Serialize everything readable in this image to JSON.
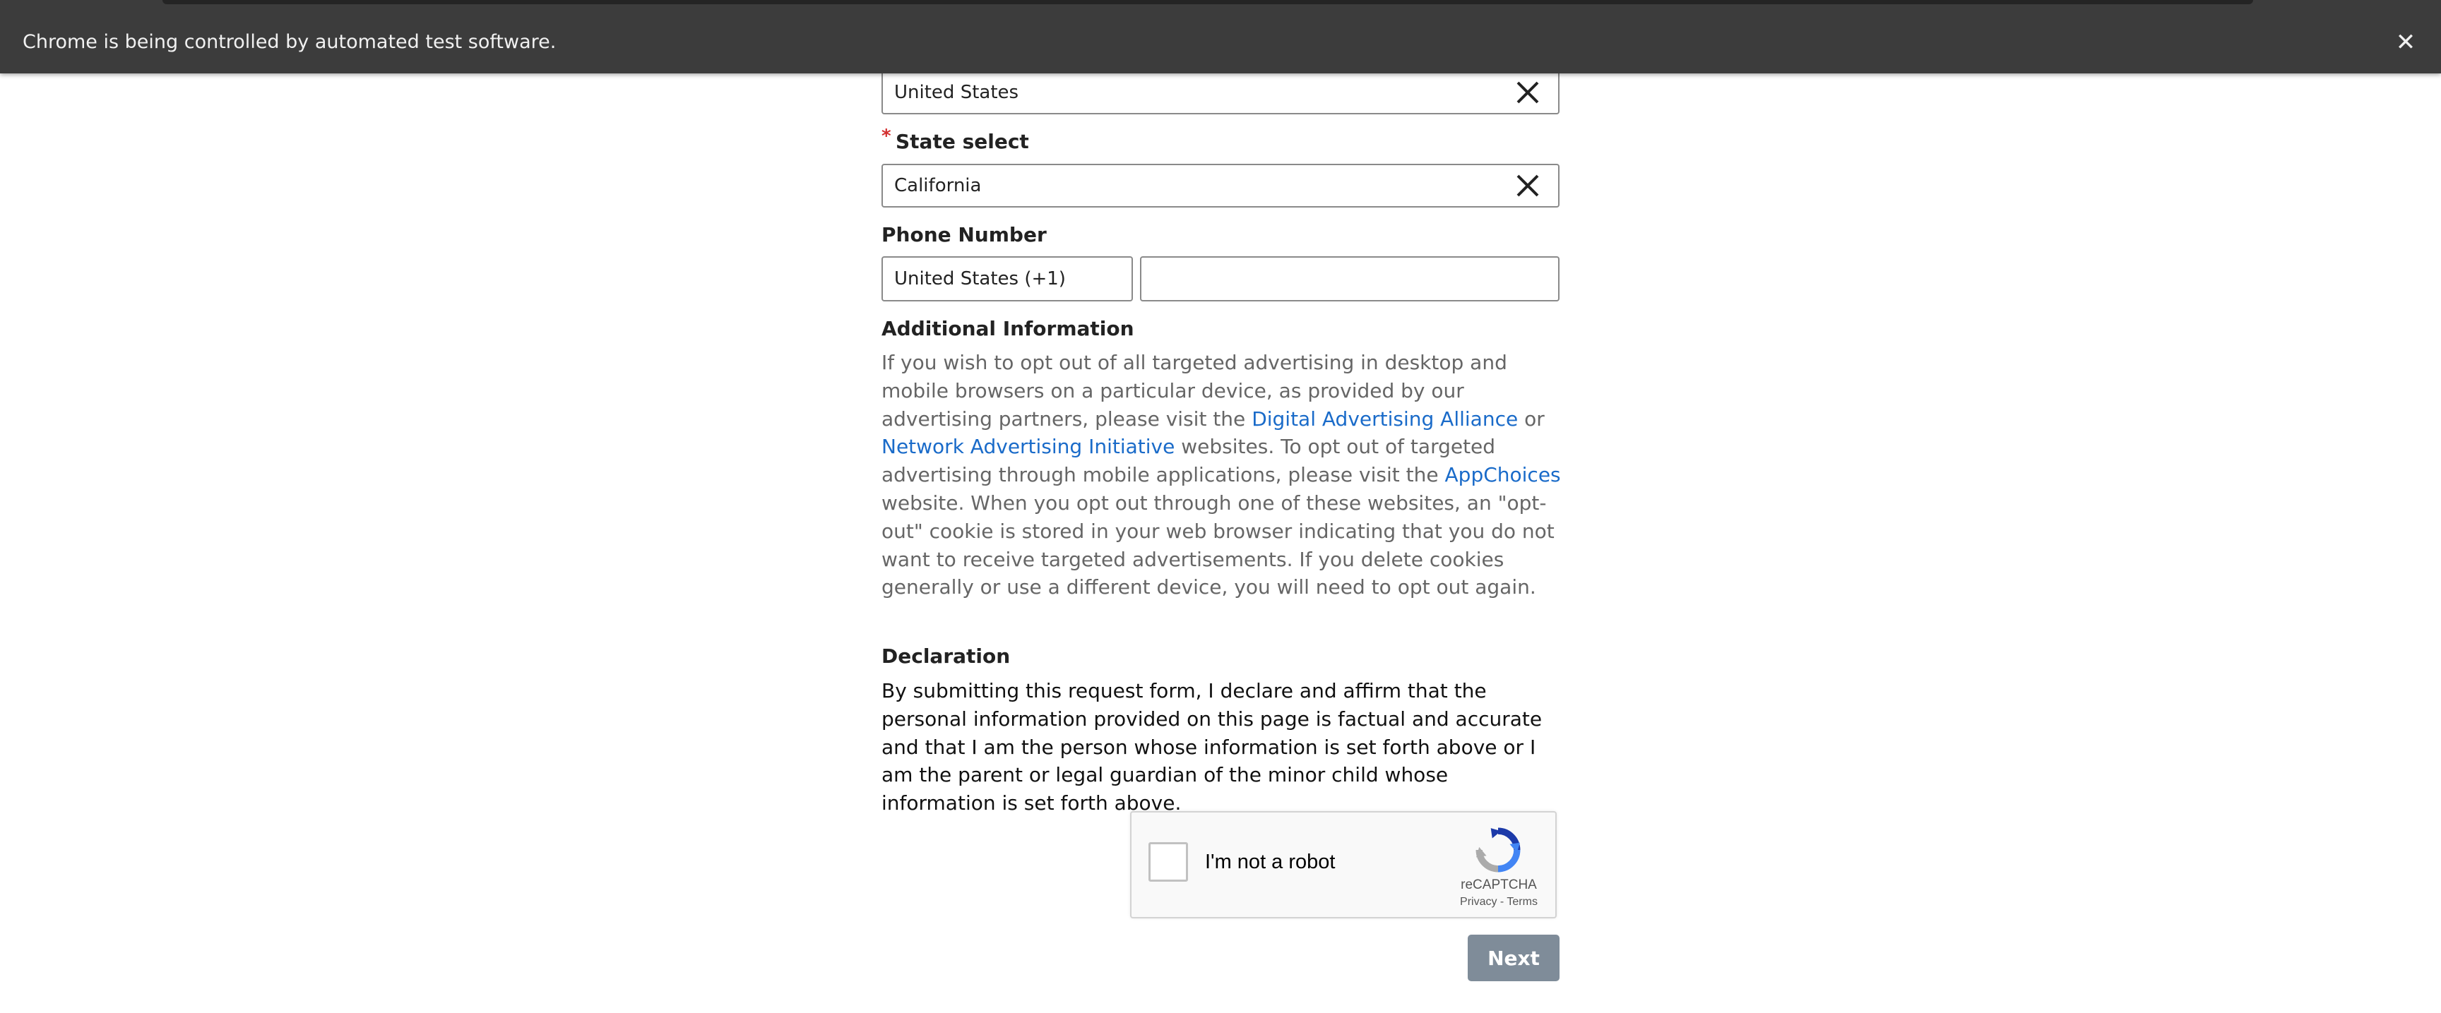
{
  "browser": {
    "infobar_message": "Chrome is being controlled by automated test software.",
    "close_icon": "close-icon"
  },
  "form": {
    "country": {
      "value": "United States",
      "clear_icon": "clear-x-icon"
    },
    "state": {
      "label": "State select",
      "required_mark": "*",
      "value": "California",
      "clear_icon": "clear-x-icon"
    },
    "phone": {
      "label": "Phone Number",
      "country_code": "United States (+1)",
      "number": ""
    },
    "additional_info": {
      "heading": "Additional Information",
      "text_1": "If you wish to opt out of all targeted advertising in desktop and mobile browsers on a particular device, as provided by our advertising partners, please visit the ",
      "link_daa": "Digital Advertising Alliance",
      "text_2": " or ",
      "link_nai": "Network Advertising Initiative",
      "text_3": " websites. To opt out of targeted advertising through mobile applications, please visit the ",
      "link_appchoices": "AppChoices",
      "text_4": " website. When you opt out through one of these websites, an \"opt-out\" cookie is stored in your web browser indicating that you do not want to receive targeted advertisements. If you delete cookies generally or use a different device, you will need to opt out again."
    },
    "declaration": {
      "heading": "Declaration",
      "text": "By submitting this request form, I declare and affirm that the personal information provided on this page is factual and accurate and that I am the person whose information is set forth above or I am the parent or legal guardian of the minor child whose information is set forth above."
    },
    "recaptcha": {
      "label": "I'm not a robot",
      "brand": "reCAPTCHA",
      "privacy": "Privacy",
      "separator": " - ",
      "terms": "Terms",
      "checked": false
    },
    "next_button": "Next"
  },
  "colors": {
    "infobar_bg": "#3c3c3c",
    "link": "#1a6bc9",
    "required": "#d32f2f",
    "next_button_bg": "#7f8c99"
  }
}
